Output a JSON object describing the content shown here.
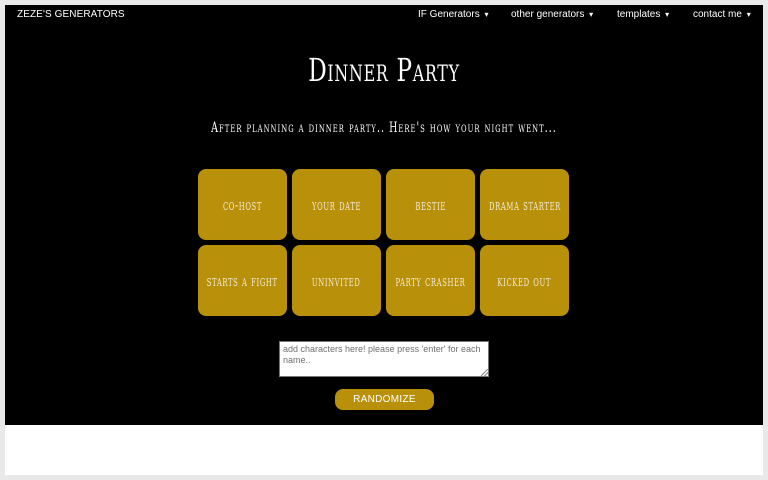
{
  "navbar": {
    "brand": "ZEZE'S GENERATORS",
    "menus": [
      {
        "label": "IF Generators",
        "caret": "▾"
      },
      {
        "label": "other generators",
        "caret": "▾"
      },
      {
        "label": "templates",
        "caret": "▾"
      },
      {
        "label": "contact me",
        "caret": "▾"
      }
    ]
  },
  "page": {
    "title": "Dinner Party",
    "subtitle": "After planning a dinner party.. Here's how your night went..."
  },
  "tiles": [
    "co-host",
    "your date",
    "bestie",
    "drama starter",
    "starts a fight",
    "uninvited",
    "party crasher",
    "kicked out"
  ],
  "input": {
    "placeholder": "add characters here! please press 'enter' for each name..",
    "value": ""
  },
  "randomize_label": "RANDOMIZE",
  "colors": {
    "background": "#000000",
    "accent": "#b8900a",
    "text": "#ffffff"
  }
}
